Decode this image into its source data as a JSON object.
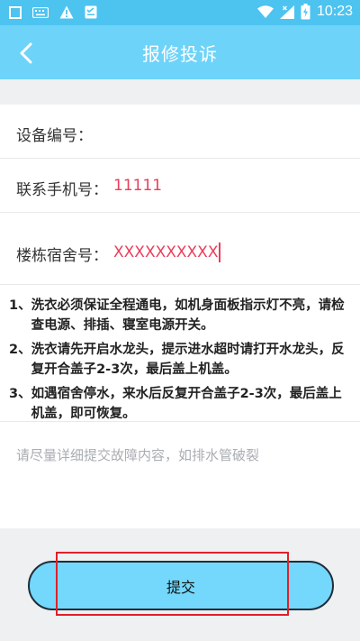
{
  "status_bar": {
    "time": "10:23",
    "left_icons": [
      "square-icon",
      "keyboard-icon",
      "warning-icon",
      "checklist-icon"
    ],
    "right_icons": [
      "wifi-icon",
      "signal-icon",
      "battery-icon"
    ]
  },
  "app_bar": {
    "title": "报修投诉",
    "back_icon": "chevron-left-icon"
  },
  "form": {
    "device_no": {
      "label": "设备编号：",
      "value": ""
    },
    "phone": {
      "label": "联系手机号：",
      "value": "11111"
    },
    "dorm": {
      "label": "楼栋宿舍号：",
      "value": "XXXXXXXXXX"
    }
  },
  "instructions": [
    {
      "num": "1、",
      "text": "洗衣必须保证全程通电，如机身面板指示灯不亮，请检查电源、排插、寝室电源开关。"
    },
    {
      "num": "2、",
      "text": "洗衣请先开启水龙头，提示进水超时请打开水龙头，反复开合盖子2-3次，最后盖上机盖。"
    },
    {
      "num": "3、",
      "text": "如遇宿舍停水，来水后反复开合盖子2-3次，最后盖上机盖，即可恢复。"
    }
  ],
  "description": {
    "placeholder": "请尽量详细提交故障内容，如排水管破裂"
  },
  "submit": {
    "label": "提交"
  },
  "colors": {
    "status_bar": "#4dc3f0",
    "app_bar": "#6ed3f8",
    "button": "#73d8fb",
    "input_value": "#ea3d5a",
    "highlight": "#e0202a"
  }
}
